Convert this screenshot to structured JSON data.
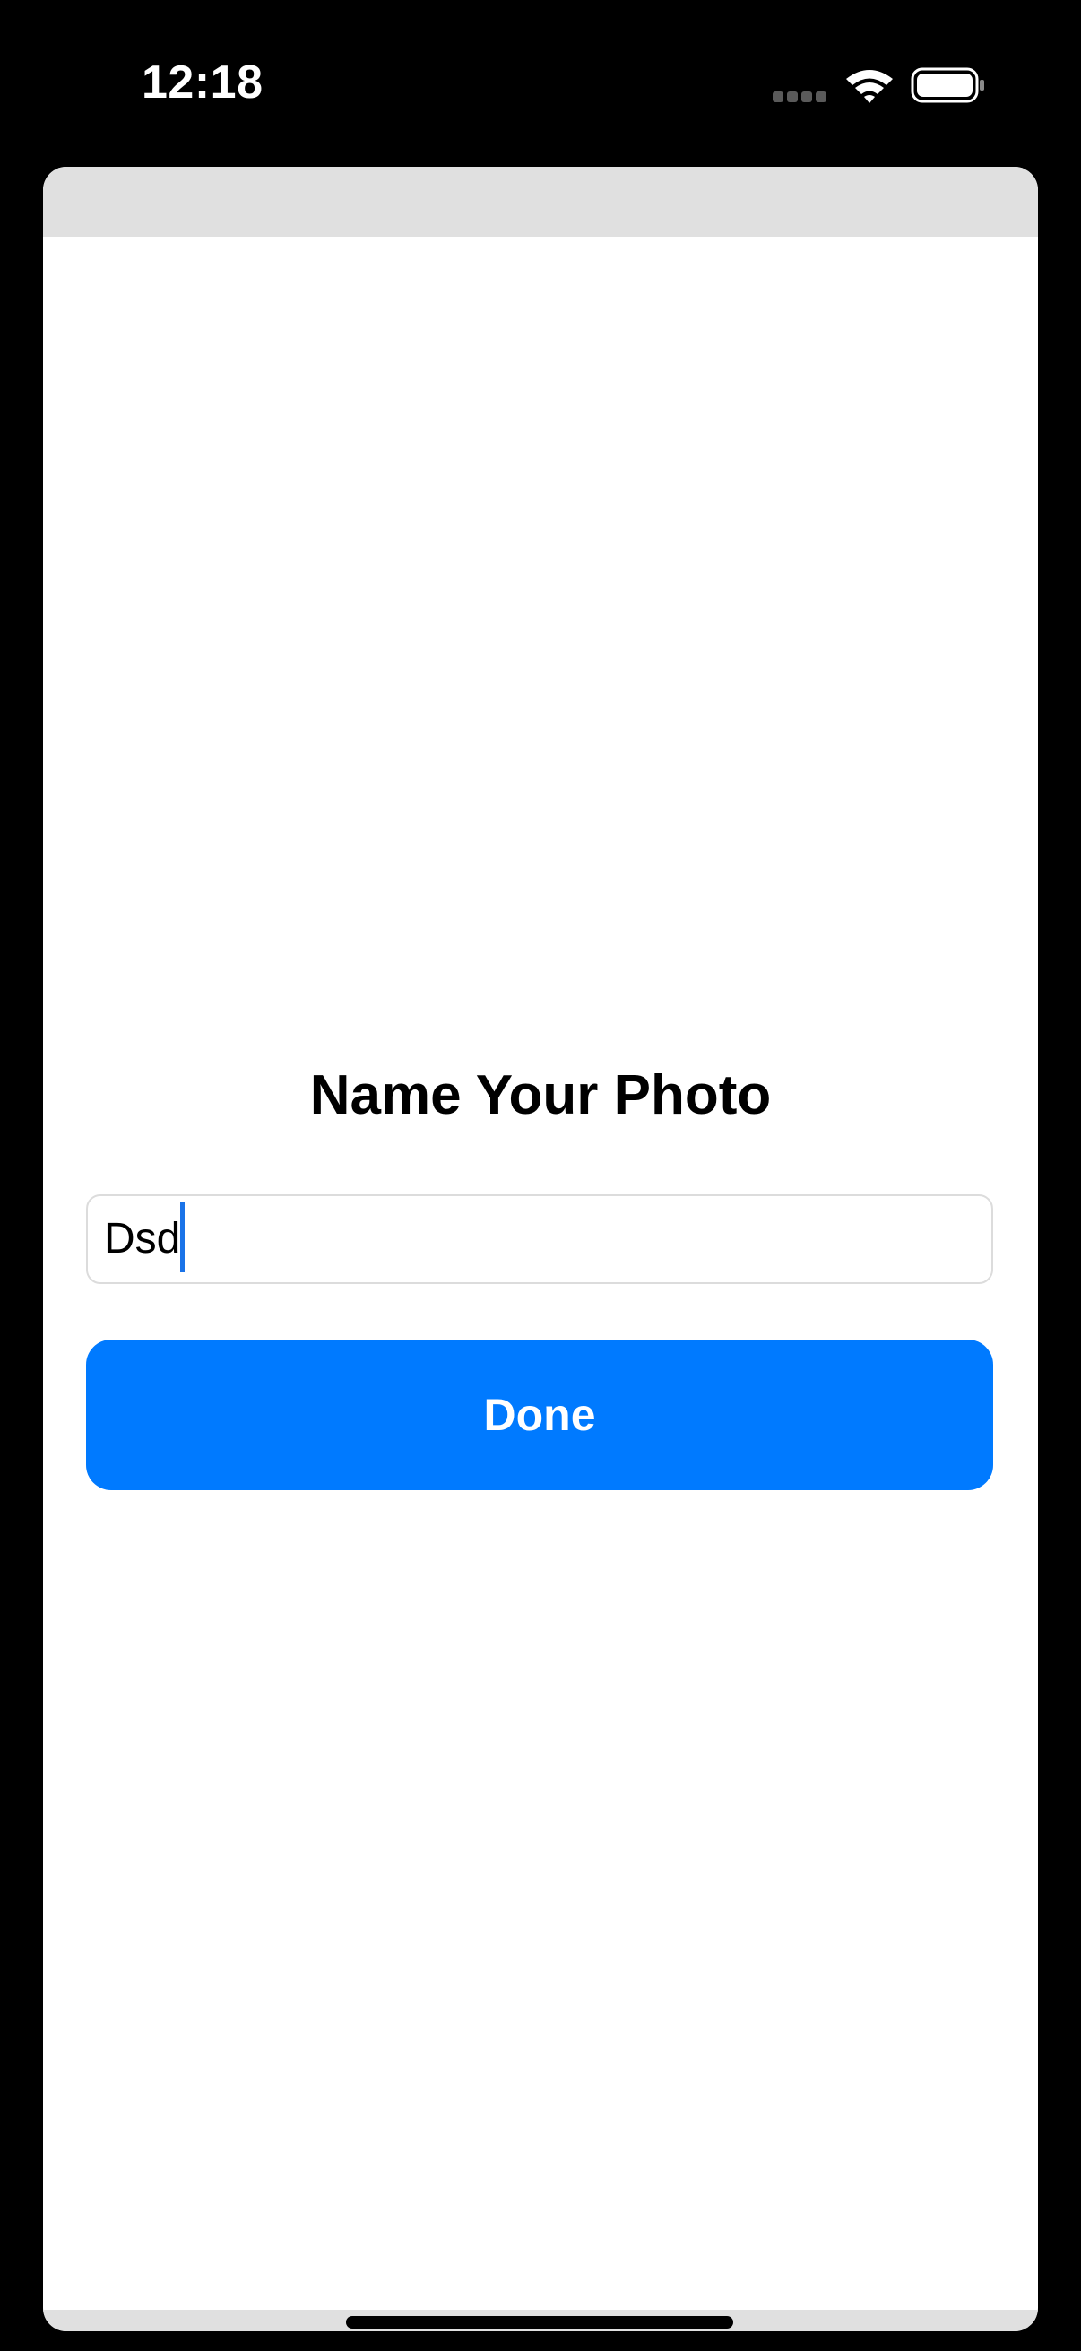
{
  "status_bar": {
    "time": "12:18",
    "icons": [
      "signal-icon",
      "wifi-icon",
      "battery-icon"
    ]
  },
  "dialog": {
    "title": "Name Your Photo",
    "name_input": {
      "value": "Dsd",
      "placeholder": ""
    },
    "done_label": "Done"
  },
  "colors": {
    "accent": "#007aff",
    "caret": "#1a73e8",
    "background": "#000000",
    "sheet": "#ffffff",
    "sheet_band": "#e0e0e0"
  }
}
